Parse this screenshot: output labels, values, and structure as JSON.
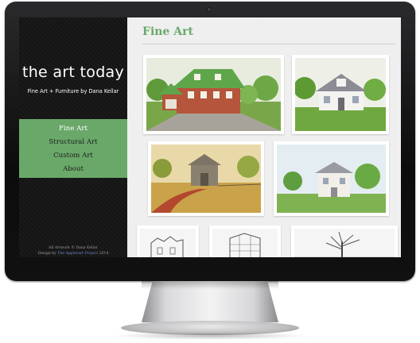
{
  "site": {
    "title": "the art today",
    "tagline": "Fine Art + Furniture by Dana Kellar"
  },
  "nav": {
    "items": [
      {
        "label": "Fine Art",
        "active": true
      },
      {
        "label": "Structural Art",
        "active": false
      },
      {
        "label": "Custom Art",
        "active": false
      },
      {
        "label": "About",
        "active": false
      }
    ]
  },
  "footer": {
    "copyright": "All Artwork © Dana Kellar",
    "design_prefix": "Design by",
    "design_link": "The Applecart Project",
    "design_year": "2014"
  },
  "page": {
    "title": "Fine Art"
  },
  "gallery": {
    "items": [
      {
        "subject": "red brick house with green roof"
      },
      {
        "subject": "white house with porch"
      },
      {
        "subject": "barn on country road"
      },
      {
        "subject": "white farmhouse among trees"
      },
      {
        "subject": "pencil sketch of townhouse"
      },
      {
        "subject": "pencil sketch of building"
      },
      {
        "subject": "pencil sketch of tree"
      }
    ]
  },
  "colors": {
    "accent_green": "#6aa86a",
    "sidebar_bg": "#141414",
    "content_bg": "#efefef"
  }
}
